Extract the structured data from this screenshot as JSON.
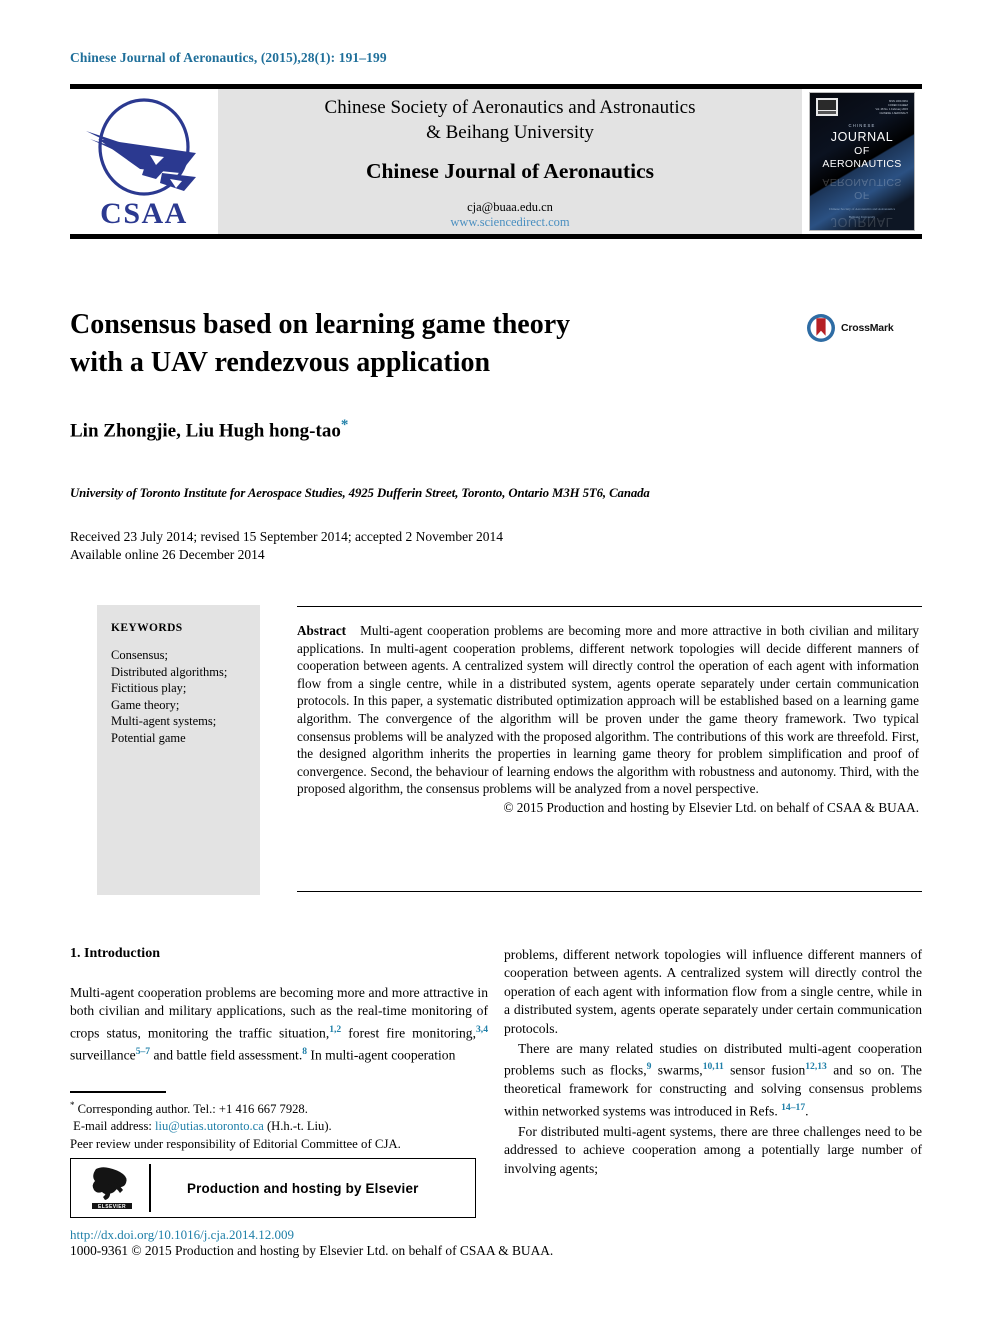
{
  "running_head": {
    "journal": "Chinese Journal of Aeronautics, (2015),",
    "volume_issue_pages": "28(1): 191–199"
  },
  "masthead": {
    "logo_text": "CSAA",
    "society_line_1": "Chinese Society of Aeronautics and Astronautics",
    "society_line_2": "& Beihang University",
    "journal_name": "Chinese Journal of Aeronautics",
    "email": "cja@buaa.edu.cn",
    "url": "www.sciencedirect.com",
    "cover": {
      "line_small": "CHINESE",
      "line_1": "JOURNAL",
      "line_2": "OF",
      "line_3": "AERONAUTICS",
      "footer_1": "Chinese Society of Aeronautics and Astronautics",
      "footer_2": "Beihang University"
    }
  },
  "article": {
    "title_line_1": "Consensus based on learning game theory",
    "title_line_2": "with a UAV rendezvous application",
    "crossmark_label": "CrossMark",
    "authors": "Lin Zhongjie, Liu Hugh hong-tao",
    "corresponding_marker": "*",
    "affiliation": "University of Toronto Institute for Aerospace Studies, 4925 Dufferin Street, Toronto, Ontario M3H 5T6, Canada",
    "received_line": "Received 23 July 2014; revised 15 September 2014; accepted 2 November 2014",
    "available_line": "Available online 26 December 2014"
  },
  "keywords": {
    "heading": "KEYWORDS",
    "items": [
      "Consensus;",
      "Distributed algorithms;",
      "Fictitious play;",
      "Game theory;",
      "Multi-agent systems;",
      "Potential game"
    ]
  },
  "abstract": {
    "label": "Abstract",
    "text": "Multi-agent cooperation problems are becoming more and more attractive in both civilian and military applications. In multi-agent cooperation problems, different network topologies will decide different manners of cooperation between agents. A centralized system will directly control the operation of each agent with information flow from a single centre, while in a distributed system, agents operate separately under certain communication protocols. In this paper, a systematic distributed optimization approach will be established based on a learning game algorithm. The convergence of the algorithm will be proven under the game theory framework. Two typical consensus problems will be analyzed with the proposed algorithm. The contributions of this work are threefold. First, the designed algorithm inherits the properties in learning game theory for problem simplification and proof of convergence. Second, the behaviour of learning endows the algorithm with robustness and autonomy. Third, with the proposed algorithm, the consensus problems will be analyzed from a novel perspective.",
    "copyright": "© 2015 Production and hosting by Elsevier Ltd. on behalf of CSAA & BUAA."
  },
  "body": {
    "section_heading": "1. Introduction",
    "left_paragraph_1_a": "Multi-agent cooperation problems are becoming more and more attractive in both civilian and military applications, such as the real-time monitoring of crops status, monitoring the traffic situation,",
    "left_ref_1": "1,2",
    "left_paragraph_1_b": " forest fire monitoring,",
    "left_ref_2": "3,4",
    "left_paragraph_1_c": " surveillance",
    "left_ref_3": "5–7",
    "left_paragraph_1_d": " and battle field assessment.",
    "left_ref_4": "8",
    "left_paragraph_1_e": " In multi-agent cooperation",
    "right_paragraph_1": "problems, different network topologies will influence different manners of cooperation between agents. A centralized system will directly control the operation of each agent with information flow from a single centre, while in a distributed system, agents operate separately under certain communication protocols.",
    "right_paragraph_2_a": "There are many related studies on distributed multi-agent cooperation problems such as flocks,",
    "right_ref_1": "9",
    "right_paragraph_2_b": " swarms,",
    "right_ref_2": "10,11",
    "right_paragraph_2_c": " sensor fusion",
    "right_ref_3": "12,13",
    "right_paragraph_2_d": " and so on. The theoretical framework for constructing and solving consensus problems within networked systems was introduced in Refs. ",
    "right_ref_4": "14–17",
    "right_paragraph_2_e": ".",
    "right_paragraph_3": "For distributed multi-agent systems, there are three challenges need to be addressed to achieve cooperation among a potentially large number of involving agents;"
  },
  "footer": {
    "corresponding_marker": "*",
    "corresponding": " Corresponding author. Tel.: +1 416 667 7928.",
    "email_label": "E-mail address: ",
    "email": "liu@utias.utoronto.ca",
    "email_suffix": " (H.h.-t. Liu).",
    "peer_review": "Peer review under responsibility of Editorial Committee of CJA.",
    "elsevier_box_text": "Production and hosting by Elsevier",
    "elsevier_logo_text": "ELSEVIER",
    "doi": "http://dx.doi.org/10.1016/j.cja.2014.12.009",
    "issn_line": "1000-9361 © 2015 Production and hosting by Elsevier Ltd. on behalf of CSAA & BUAA."
  },
  "colors": {
    "link": "#1f7fa8",
    "runhead": "#1f6f9a",
    "logo_navy": "#2b3990",
    "masthead_grey": "#e3e3e3",
    "crossmark_red": "#b52025",
    "crossmark_blue": "#2e6ca4"
  }
}
